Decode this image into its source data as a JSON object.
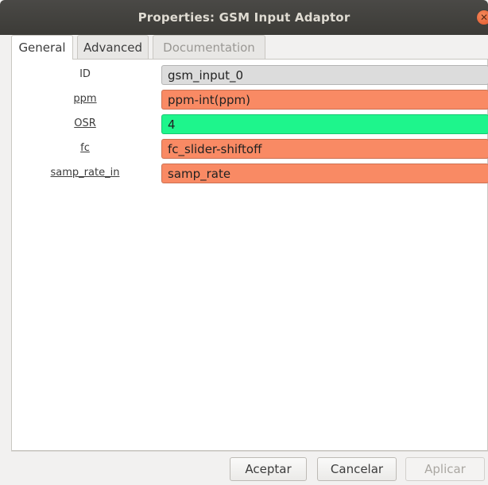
{
  "window": {
    "title": "Properties: GSM Input Adaptor",
    "close_icon": "close-icon"
  },
  "tabs": [
    {
      "label": "General",
      "state": "active"
    },
    {
      "label": "Advanced",
      "state": "normal"
    },
    {
      "label": "Documentation",
      "state": "disabled"
    }
  ],
  "params": [
    {
      "label": "ID",
      "value": "gsm_input_0",
      "bg": "#dcdcdc",
      "link": false
    },
    {
      "label": "ppm",
      "value": "ppm-int(ppm)",
      "bg": "#f98a64",
      "link": true
    },
    {
      "label": "OSR",
      "value": "4",
      "bg": "#1ef58c",
      "link": true
    },
    {
      "label": "fc",
      "value": "fc_slider-shiftoff",
      "bg": "#f98a64",
      "link": true
    },
    {
      "label": "samp_rate_in",
      "value": "samp_rate",
      "bg": "#f98a64",
      "link": true
    }
  ],
  "buttons": {
    "accept": "Aceptar",
    "cancel": "Cancelar",
    "apply": "Aplicar"
  }
}
